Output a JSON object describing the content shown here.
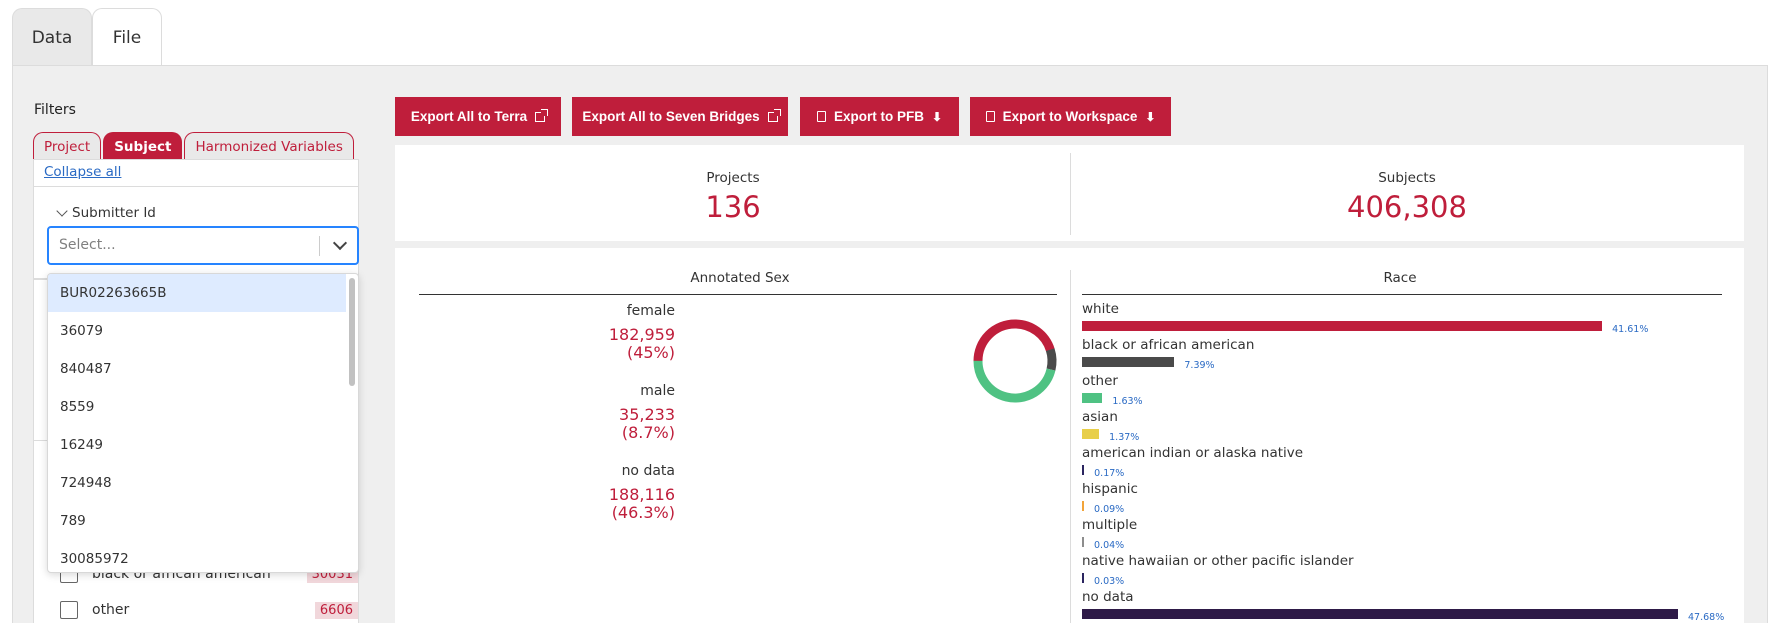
{
  "top_tabs": [
    {
      "label": "Data"
    },
    {
      "label": "File"
    }
  ],
  "filters": {
    "title": "Filters",
    "tabs": [
      {
        "label": "Project"
      },
      {
        "label": "Subject"
      },
      {
        "label": "Harmonized Variables"
      }
    ],
    "collapse_all": "Collapse all",
    "section_title": "Submitter Id",
    "select_placeholder": "Select...",
    "dropdown_options": [
      "BUR02263665B",
      "36079",
      "840487",
      "8559",
      "16249",
      "724948",
      "789",
      "30085972"
    ],
    "bottom_rows": [
      {
        "label": "black or african american",
        "count": "30031"
      },
      {
        "label": "other",
        "count": "6606"
      }
    ]
  },
  "export_buttons": [
    {
      "label": "Export All to Terra"
    },
    {
      "label": "Export All to Seven Bridges"
    },
    {
      "label": "Export to PFB"
    },
    {
      "label": "Export to Workspace"
    }
  ],
  "stats": {
    "projects_label": "Projects",
    "projects_value": "136",
    "subjects_label": "Subjects",
    "subjects_value": "406,308"
  },
  "colors": {
    "brand_red": "#bf1e3b",
    "link_blue": "#2a6ac4",
    "focus_blue": "#2684ff"
  },
  "chart_data": [
    {
      "type": "pie",
      "title": "Annotated Sex",
      "categories": [
        "female",
        "male",
        "no data"
      ],
      "values": [
        182959,
        35233,
        188116
      ],
      "value_labels": [
        "182,959",
        "35,233",
        "188,116"
      ],
      "percent_labels": [
        "(45%)",
        "(8.7%)",
        "(46.3%)"
      ],
      "colors": [
        "#bf1e3b",
        "#4a4a4a",
        "#4fc283"
      ]
    },
    {
      "type": "bar",
      "title": "Race",
      "categories": [
        "white",
        "black or african american",
        "other",
        "asian",
        "american indian or alaska native",
        "hispanic",
        "multiple",
        "native hawaiian or other pacific islander",
        "no data"
      ],
      "values": [
        41.61,
        7.39,
        1.63,
        1.37,
        0.17,
        0.09,
        0.04,
        0.03,
        47.68
      ],
      "value_labels": [
        "41.61%",
        "7.39%",
        "1.63%",
        "1.37%",
        "0.17%",
        "0.09%",
        "0.04%",
        "0.03%",
        "47.68%"
      ],
      "colors": [
        "#bf1e3b",
        "#4a4a4a",
        "#4fc283",
        "#e8cf4a",
        "#2b2560",
        "#f2a43a",
        "#8d8d8d",
        "#2b2560",
        "#2e1a47"
      ]
    }
  ]
}
